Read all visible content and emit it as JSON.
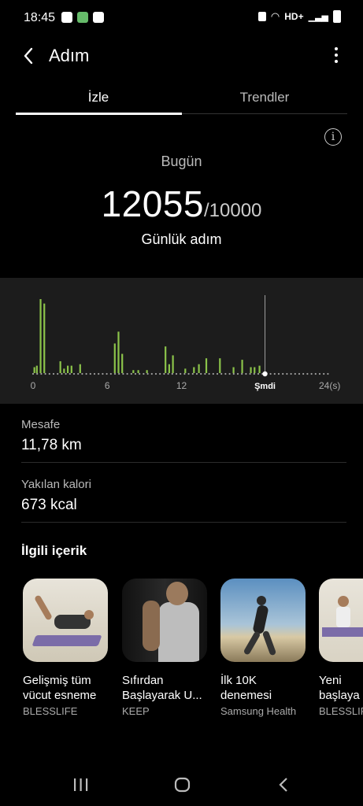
{
  "status_bar": {
    "time": "18:45",
    "right_text": "HD+"
  },
  "header": {
    "title": "Adım"
  },
  "tabs": [
    {
      "label": "İzle"
    },
    {
      "label": "Trendler"
    }
  ],
  "summary": {
    "period": "Bugün",
    "steps": "12055",
    "goal": "/10000",
    "caption": "Günlük adım"
  },
  "chart_data": {
    "type": "bar",
    "x_ticks": [
      "0",
      "6",
      "12",
      "Şmdi",
      "24(s)"
    ],
    "xlim": [
      0,
      24
    ],
    "bar_color": "#8bc34a",
    "now_hour": 18.75,
    "bars": [
      {
        "x": 0.1,
        "y": 0.08
      },
      {
        "x": 0.3,
        "y": 0.1
      },
      {
        "x": 0.6,
        "y": 1.0
      },
      {
        "x": 0.9,
        "y": 0.94
      },
      {
        "x": 2.2,
        "y": 0.16
      },
      {
        "x": 2.5,
        "y": 0.06
      },
      {
        "x": 2.8,
        "y": 0.1
      },
      {
        "x": 3.1,
        "y": 0.1
      },
      {
        "x": 3.8,
        "y": 0.12
      },
      {
        "x": 6.6,
        "y": 0.4
      },
      {
        "x": 6.9,
        "y": 0.56
      },
      {
        "x": 7.2,
        "y": 0.26
      },
      {
        "x": 8.1,
        "y": 0.04
      },
      {
        "x": 8.5,
        "y": 0.04
      },
      {
        "x": 9.2,
        "y": 0.04
      },
      {
        "x": 10.7,
        "y": 0.36
      },
      {
        "x": 11.0,
        "y": 0.12
      },
      {
        "x": 11.3,
        "y": 0.24
      },
      {
        "x": 12.3,
        "y": 0.06
      },
      {
        "x": 13.0,
        "y": 0.08
      },
      {
        "x": 13.4,
        "y": 0.12
      },
      {
        "x": 14.0,
        "y": 0.2
      },
      {
        "x": 15.1,
        "y": 0.2
      },
      {
        "x": 16.2,
        "y": 0.08
      },
      {
        "x": 16.9,
        "y": 0.18
      },
      {
        "x": 17.6,
        "y": 0.08
      },
      {
        "x": 17.9,
        "y": 0.08
      },
      {
        "x": 18.3,
        "y": 0.1
      }
    ]
  },
  "stats": [
    {
      "label": "Mesafe",
      "value": "11,78 km"
    },
    {
      "label": "Yakılan kalori",
      "value": "673 kcal"
    }
  ],
  "related": {
    "title": "İlgili içerik",
    "cards": [
      {
        "title": "Gelişmiş tüm\nvücut esneme",
        "source": "BLESSLIFE"
      },
      {
        "title": "Sıfırdan\nBaşlayarak U...",
        "source": "KEEP"
      },
      {
        "title": "İlk 10K\ndenemesi",
        "source": "Samsung Health"
      },
      {
        "title": "Yeni\nbaşlaya",
        "source": "BLESSLIF"
      }
    ]
  },
  "colors": {
    "accent": "#8bc34a",
    "background": "#000000",
    "panel": "#1c1c1c"
  }
}
